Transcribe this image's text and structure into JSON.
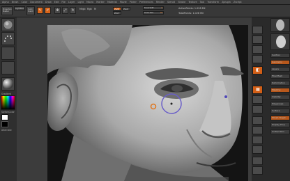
{
  "menu": [
    "Alpha",
    "Brush",
    "Color",
    "Document",
    "Draw",
    "Edit",
    "File",
    "Layer",
    "Light",
    "Macro",
    "Marker",
    "Material",
    "Movie",
    "Picker",
    "Preferences",
    "Render",
    "Stencil",
    "Stroke",
    "Texture",
    "Tool",
    "Transform",
    "Zplugin",
    "Zscript"
  ],
  "toolbar": {
    "projection_label": "Projection Master",
    "lightbox_label": "LightBox",
    "quick_sketch_label": "Quick Sketch",
    "edit_label": "Edit",
    "draw_label": "Draw",
    "move_label": "Move",
    "scale_label": "Scale",
    "rotate_label": "Rotate",
    "mrgb_label": "Mrgb",
    "rgb_label": "Rgb",
    "m_label": "M",
    "zadd_label": "Zadd",
    "zsub_label": "Zsub",
    "zcut_label": "Zcut",
    "focal_shift_label": "Focal Shift",
    "focal_shift_value": "0",
    "draw_size_label": "Draw Size",
    "draw_size_value": "38",
    "rgb_intensity_label": "Rgb Intensity",
    "z_intensity_label": "Z Intensity",
    "active_points_label": "ActivePoints: 1.028 Mil",
    "total_points_label": "TotalPoints: 1.028 Mil"
  },
  "left_tray": {
    "gradient_label": "Gradient",
    "switch_color_label": "SwitchColor",
    "alternate_label": "Alternate"
  },
  "right_panel": {
    "rows": [
      "SubTool",
      "Geometry",
      "Layers",
      "FiberMesh",
      "Deformation",
      "Masking",
      "Visibility",
      "Polygroups",
      "Surface",
      "Morph Target",
      "Display Prop",
      "Unified Skin"
    ]
  },
  "colors": {
    "accent": "#d8651a",
    "cursor_ring": "#6a5fc8",
    "cursor_marker": "#e0761e"
  }
}
